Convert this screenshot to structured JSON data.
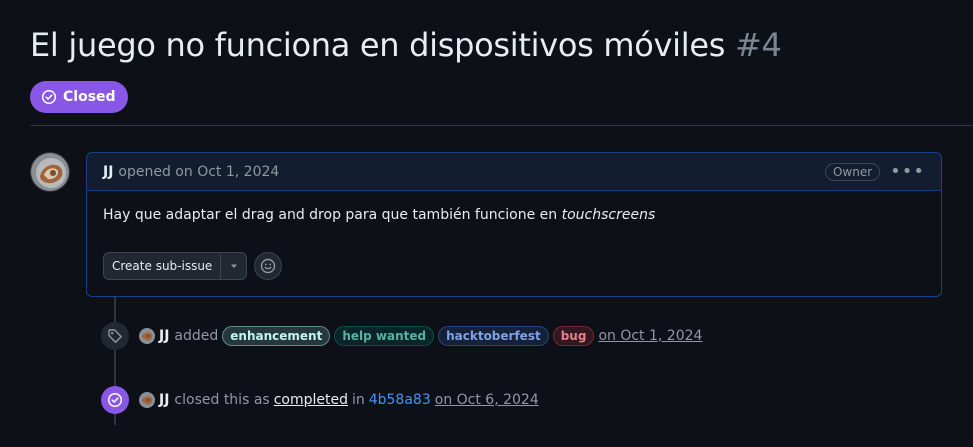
{
  "issue": {
    "title": "El juego no funciona en dispositivos móviles",
    "number": "#4",
    "state": "Closed"
  },
  "comment": {
    "author": "JJ",
    "meta": "opened on Oct 1, 2024",
    "role_badge": "Owner",
    "body_text": "Hay que adaptar el drag and drop para que también funcione en ",
    "body_emphasis": "touchscreens",
    "sub_issue_button": "Create sub-issue",
    "emoji_icon": "smiley-icon"
  },
  "events": {
    "labeled": {
      "author": "JJ",
      "action": "added",
      "labels": [
        {
          "name": "enhancement",
          "color": "#a2eeef"
        },
        {
          "name": "help wanted",
          "color": "#008672"
        },
        {
          "name": "hacktoberfest",
          "color": "#3b6fd4"
        },
        {
          "name": "bug",
          "color": "#d73a4a"
        }
      ],
      "date": "on Oct 1, 2024"
    },
    "closed": {
      "author": "JJ",
      "action": "closed this as",
      "reason": "completed",
      "in_text": "in",
      "commit": "4b58a83",
      "date": "on Oct 6, 2024"
    }
  },
  "colors": {
    "closed_purple": "#8957e5",
    "link_blue": "#4493f8",
    "background": "#0d1117"
  }
}
